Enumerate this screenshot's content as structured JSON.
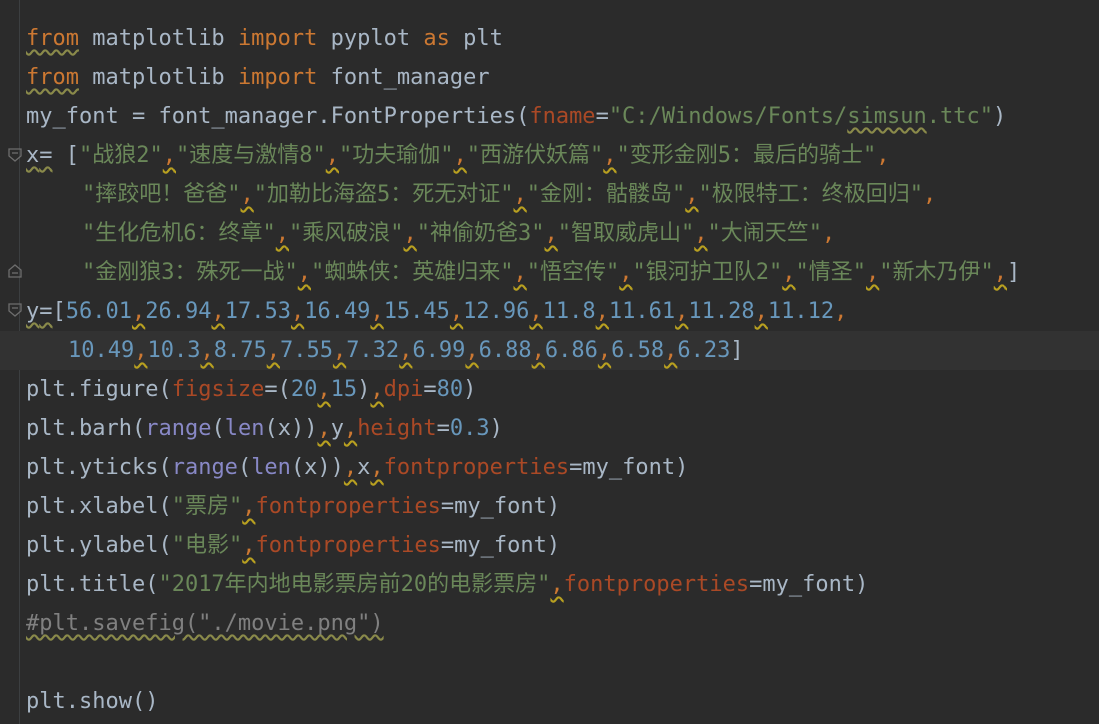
{
  "colors": {
    "background": "#2b2b2b",
    "current_line": "#323232",
    "keyword": "#cc7832",
    "string": "#6a8759",
    "number": "#6897bb",
    "param": "#aa4926",
    "builtin": "#8888c6",
    "comment": "#808080",
    "text": "#a9b7c6"
  },
  "icons": [
    "fold-open-icon",
    "fold-close-icon"
  ],
  "code": {
    "l1": {
      "kw1": "from",
      "mod": " matplotlib ",
      "kw2": "import",
      "rest": " pyplot ",
      "kw3": "as",
      "alias": " plt"
    },
    "l2": {
      "kw1": "from",
      "mod": " matplotlib ",
      "kw2": "import",
      "rest": " font_manager"
    },
    "l3": {
      "pre": "my_font = font_manager.FontProperties(",
      "param": "fname",
      "eq": "=",
      "str": "\"C:/Windows/Fonts/",
      "str_w": "simsun",
      "str_end": ".ttc\"",
      "close": ")"
    },
    "l4": {
      "x": "x",
      "eq": "=",
      "open": " [",
      "items": [
        "\"战狼2\"",
        "\"速度与激情8\"",
        "\"功夫瑜伽\"",
        "\"西游伏妖篇\"",
        "\"变形金刚5：最后的骑士\""
      ]
    },
    "l5": {
      "items": [
        "\"摔跤吧！爸爸\"",
        "\"加勒比海盗5：死无对证\"",
        "\"金刚：骷髅岛\"",
        "\"极限特工：终极回归\""
      ]
    },
    "l6": {
      "items": [
        "\"生化危机6：终章\"",
        "\"乘风破浪\"",
        "\"神偷奶爸3\"",
        "\"智取威虎山\"",
        "\"大闹天竺\""
      ]
    },
    "l7": {
      "items": [
        "\"金刚狼3：殊死一战\"",
        "\"蜘蛛侠：英雄归来\"",
        "\"悟空传\"",
        "\"银河护卫队2\"",
        "\"情圣\"",
        "\"新木乃伊\""
      ],
      "close": "]"
    },
    "l8": {
      "y": "y",
      "eq": "=",
      "open": "[",
      "nums": [
        "56.01",
        "26.94",
        "17.53",
        "16.49",
        "15.45",
        "12.96",
        "11.8",
        "11.61",
        "11.28",
        "11.12"
      ]
    },
    "l9": {
      "nums": [
        "10.49",
        "10.3",
        "8.75",
        "7.55",
        "7.32",
        "6.99",
        "6.88",
        "6.86",
        "6.58",
        "6.23"
      ],
      "close": "]"
    },
    "l10": {
      "pre": "plt.figure(",
      "p1": "figsize",
      "eq1": "=(",
      "n1": "20",
      "n2": "15",
      "mid": ")",
      "p2": "dpi",
      "eq2": "=",
      "n3": "80",
      "close": ")"
    },
    "l11": {
      "pre": "plt.barh(",
      "b1": "range",
      "o1": "(",
      "b2": "len",
      "o2": "(x))",
      "y": "y",
      "p": "height",
      "eq": "=",
      "n": "0.3",
      "close": ")"
    },
    "l12": {
      "pre": "plt.yticks(",
      "b1": "range",
      "o1": "(",
      "b2": "len",
      "o2": "(x))",
      "x": "x",
      "p": "fontproperties",
      "eq": "=my_font)"
    },
    "l13": {
      "pre": "plt.xlabel(",
      "s": "\"票房\"",
      "p": "fontproperties",
      "eq": "=my_font)"
    },
    "l14": {
      "pre": "plt.ylabel(",
      "s": "\"电影\"",
      "p": "fontproperties",
      "eq": "=my_font)"
    },
    "l15": {
      "pre": "plt.title(",
      "s": "\"2017年内地电影票房前20的电影票房\"",
      "p": "fontproperties",
      "eq": "=my_font)"
    },
    "l16": {
      "c": "#plt.savefig(\"./movie.png\")"
    },
    "l17": {
      "t": "plt.show()"
    }
  }
}
